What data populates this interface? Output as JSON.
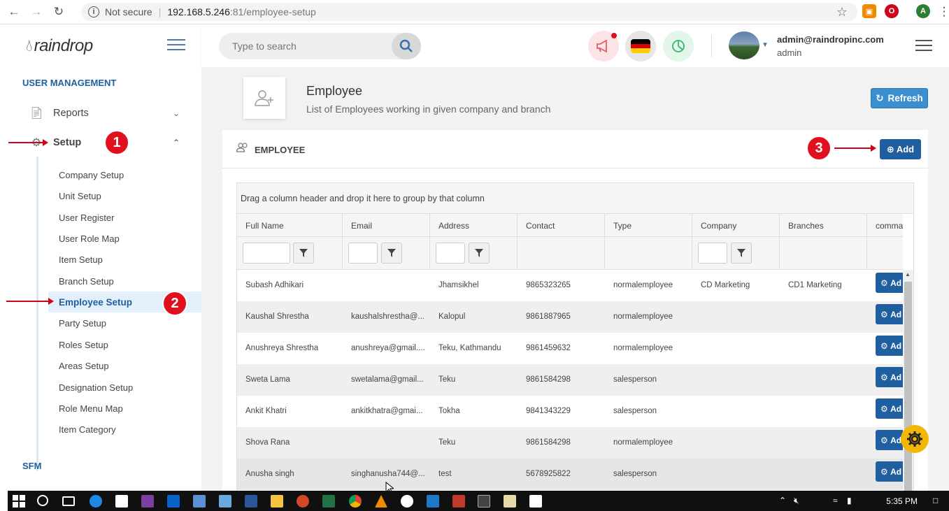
{
  "browser": {
    "not_secure": "Not secure",
    "url_host": "192.168.5.246",
    "url_path": ":81/employee-setup"
  },
  "sidebar": {
    "logo": "raindrop",
    "section_user_management": "USER MANAGEMENT",
    "reports": "Reports",
    "setup": "Setup",
    "sub_items": [
      "Company Setup",
      "Unit Setup",
      "User Register",
      "User Role Map",
      "Item Setup",
      "Branch Setup",
      "Employee Setup",
      "Party Setup",
      "Roles Setup",
      "Areas Setup",
      "Designation Setup",
      "Role Menu Map",
      "Item Category"
    ],
    "section_sfm": "SFM"
  },
  "topbar": {
    "search_placeholder": "Type to search",
    "user_email": "admin@raindropinc.com",
    "user_role": "admin"
  },
  "page": {
    "title": "Employee",
    "subtitle": "List of Employees working in given company and branch",
    "refresh_label": "Refresh"
  },
  "card": {
    "title": "EMPLOYEE",
    "add_label": "Add"
  },
  "grid": {
    "group_hint": "Drag a column header and drop it here to group by that column",
    "columns": [
      "Full Name",
      "Email",
      "Address",
      "Contact",
      "Type",
      "Company",
      "Branches",
      "comma"
    ],
    "rows": [
      {
        "name": "Subash Adhikari",
        "email": "",
        "address": "Jhamsikhel",
        "contact": "9865323265",
        "type": "normalemployee",
        "company": "CD Marketing",
        "branches": "CD1 Marketing"
      },
      {
        "name": "Kaushal Shrestha",
        "email": "kaushalshrestha@...",
        "address": "Kalopul",
        "contact": "9861887965",
        "type": "normalemployee",
        "company": "",
        "branches": ""
      },
      {
        "name": "Anushreya Shrestha",
        "email": "anushreya@gmail....",
        "address": "Teku, Kathmandu",
        "contact": "9861459632",
        "type": "normalemployee",
        "company": "",
        "branches": ""
      },
      {
        "name": "Sweta Lama",
        "email": "swetalama@gmail...",
        "address": "Teku",
        "contact": "9861584298",
        "type": "salesperson",
        "company": "",
        "branches": ""
      },
      {
        "name": "Ankit Khatri",
        "email": "ankitkhatra@gmai...",
        "address": "Tokha",
        "contact": "9841343229",
        "type": "salesperson",
        "company": "",
        "branches": ""
      },
      {
        "name": "Shova Rana",
        "email": "",
        "address": "Teku",
        "contact": "9861584298",
        "type": "normalemployee",
        "company": "",
        "branches": ""
      },
      {
        "name": "Anusha singh",
        "email": "singhanusha744@...",
        "address": "test",
        "contact": "5678925822",
        "type": "salesperson",
        "company": "",
        "branches": ""
      }
    ],
    "command_label": "Ad"
  },
  "annotations": [
    "1",
    "2",
    "3"
  ],
  "taskbar": {
    "time": "5:35 PM"
  },
  "colors": {
    "accent": "#1f5fa0",
    "refresh": "#3a8fd1",
    "annotation": "#e0101e"
  }
}
